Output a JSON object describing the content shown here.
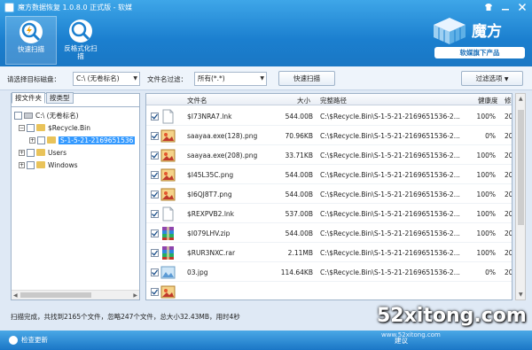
{
  "window": {
    "title": "魔方数据恢复 1.0.8.0 正式版 - 软媒",
    "controls": [
      "shirt",
      "minimize",
      "close"
    ]
  },
  "toolbar": {
    "quick_scan_label": "快速扫描",
    "format_scan_label": "反格式化扫描"
  },
  "brand": {
    "name": "魔方",
    "sub": "软媒旗下产品"
  },
  "filter": {
    "disk_label": "请选择目标磁盘：",
    "disk_value": "C:\\ (无卷标名)",
    "filter_label": "文件名过滤：",
    "filter_value": "所有(*.*)",
    "quick_scan_button": "快速扫描",
    "filter_options_button": "过滤选项"
  },
  "left_panel": {
    "tabs": [
      "按文件夹",
      "按类型"
    ],
    "tree": [
      {
        "label": "C:\\ (无卷标名)",
        "kind": "drive",
        "expander": "",
        "level": 0
      },
      {
        "label": "$Recycle.Bin",
        "kind": "folder",
        "expander": "−",
        "level": 1
      },
      {
        "label": "S-1-5-21-2169651536",
        "kind": "folder",
        "expander": "+",
        "level": 2,
        "selected": true
      },
      {
        "label": "Users",
        "kind": "folder",
        "expander": "+",
        "level": 1
      },
      {
        "label": "Windows",
        "kind": "folder",
        "expander": "+",
        "level": 1
      }
    ]
  },
  "table": {
    "columns": [
      "文件名",
      "大小",
      "完整路径",
      "健康度",
      "修"
    ],
    "rows": [
      {
        "name": "$I73NRA7.lnk",
        "size": "544.00B",
        "path": "C:\\$Recycle.Bin\\S-1-5-21-2169651536-2...",
        "health": "100%",
        "mod": "20",
        "icon": "doc-icon"
      },
      {
        "name": "saayaa.exe(128).png",
        "size": "70.96KB",
        "path": "C:\\$Recycle.Bin\\S-1-5-21-2169651536-2...",
        "health": "0%",
        "mod": "20",
        "icon": "image-icon"
      },
      {
        "name": "saayaa.exe(208).png",
        "size": "33.71KB",
        "path": "C:\\$Recycle.Bin\\S-1-5-21-2169651536-2...",
        "health": "100%",
        "mod": "20",
        "icon": "image-icon"
      },
      {
        "name": "$I45L35C.png",
        "size": "544.00B",
        "path": "C:\\$Recycle.Bin\\S-1-5-21-2169651536-2...",
        "health": "100%",
        "mod": "20",
        "icon": "image-icon"
      },
      {
        "name": "$I6QJ8T7.png",
        "size": "544.00B",
        "path": "C:\\$Recycle.Bin\\S-1-5-21-2169651536-2...",
        "health": "100%",
        "mod": "20",
        "icon": "image-icon"
      },
      {
        "name": "$REXPVB2.lnk",
        "size": "537.00B",
        "path": "C:\\$Recycle.Bin\\S-1-5-21-2169651536-2...",
        "health": "100%",
        "mod": "20",
        "icon": "doc-icon"
      },
      {
        "name": "$I079LHV.zip",
        "size": "544.00B",
        "path": "C:\\$Recycle.Bin\\S-1-5-21-2169651536-2...",
        "health": "100%",
        "mod": "20",
        "icon": "archive-icon"
      },
      {
        "name": "$RUR3NXC.rar",
        "size": "2.11MB",
        "path": "C:\\$Recycle.Bin\\S-1-5-21-2169651536-2...",
        "health": "100%",
        "mod": "20",
        "icon": "archive-icon"
      },
      {
        "name": "03.jpg",
        "size": "114.64KB",
        "path": "C:\\$Recycle.Bin\\S-1-5-21-2169651536-2...",
        "health": "0%",
        "mod": "20",
        "icon": "photo-icon"
      },
      {
        "name": "",
        "size": "",
        "path": "",
        "health": "",
        "mod": "",
        "icon": "image-icon"
      }
    ]
  },
  "status": {
    "text": "扫描完成，共找到2165个文件，忽略247个文件，总大小32.43MB，用时4秒"
  },
  "footer": {
    "update_label": "检查更新",
    "hint_label": "建议"
  },
  "watermark": {
    "text": "52xitong.com",
    "sub": "www.52xitong.com"
  },
  "colors": {
    "titlebar": "#1b7fcf",
    "selection": "#3399ff"
  }
}
